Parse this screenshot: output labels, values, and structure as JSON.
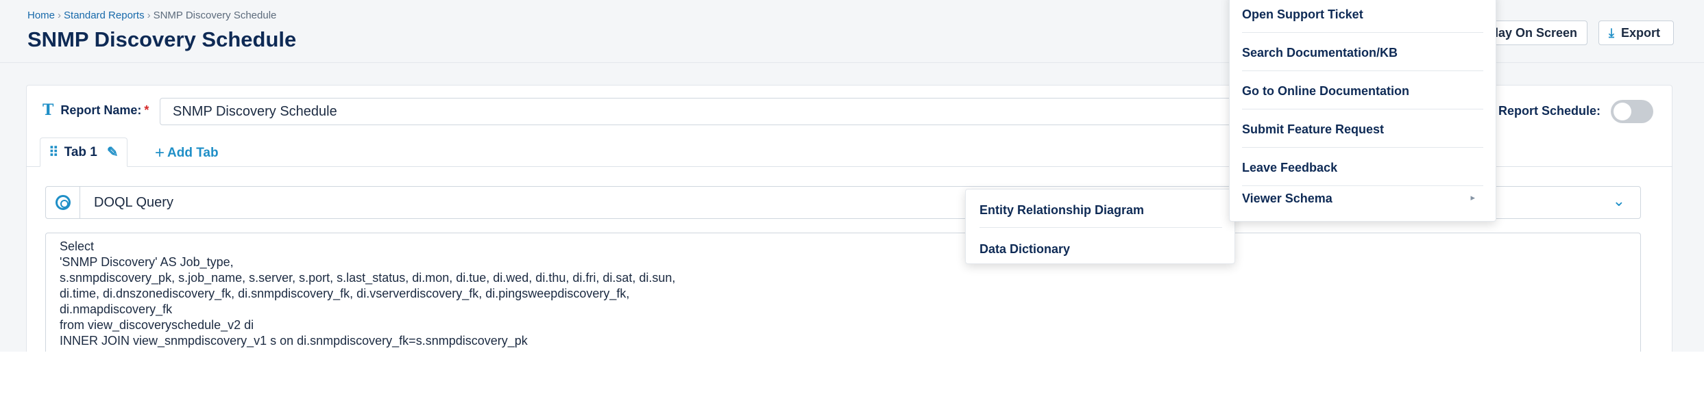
{
  "breadcrumb": {
    "home": "Home",
    "reports": "Standard Reports",
    "current": "SNMP Discovery Schedule",
    "separator": "›"
  },
  "page": {
    "title": "SNMP Discovery Schedule"
  },
  "header_actions": {
    "display_on_screen": "lay On Screen",
    "export": "Export",
    "export_icon": "download-icon"
  },
  "report": {
    "name_label": "Report Name:",
    "required_mark": "*",
    "name_value": "SNMP Discovery Schedule",
    "schedule_label": "Report Schedule:",
    "schedule_enabled": false
  },
  "tabs": {
    "items": [
      {
        "label": "Tab 1"
      }
    ],
    "add_label": "Add Tab"
  },
  "query": {
    "type_label": "DOQL Query"
  },
  "editor": {
    "lines": [
      "Select",
      "'SNMP Discovery' AS Job_type,",
      "s.snmpdiscovery_pk, s.job_name, s.server, s.port, s.last_status, di.mon, di.tue, di.wed, di.thu, di.fri, di.sat, di.sun,",
      "di.time, di.dnszonediscovery_fk, di.snmpdiscovery_fk, di.vserverdiscovery_fk, di.pingsweepdiscovery_fk,",
      "di.nmapdiscovery_fk",
      "",
      "from view_discoveryschedule_v2 di",
      "INNER JOIN view_snmpdiscovery_v1 s on di.snmpdiscovery_fk=s.snmpdiscovery_pk"
    ]
  },
  "help_menu": {
    "items": [
      "Open Support Ticket",
      "Search Documentation/KB",
      "Go to Online Documentation",
      "Submit Feature Request",
      "Leave Feedback",
      "Viewer Schema"
    ]
  },
  "viewer_schema_submenu": {
    "items": [
      "Entity Relationship Diagram",
      "Data Dictionary"
    ]
  },
  "colors": {
    "accent": "#1f8fc7",
    "title": "#0e2a55",
    "required": "#d62b2b"
  }
}
